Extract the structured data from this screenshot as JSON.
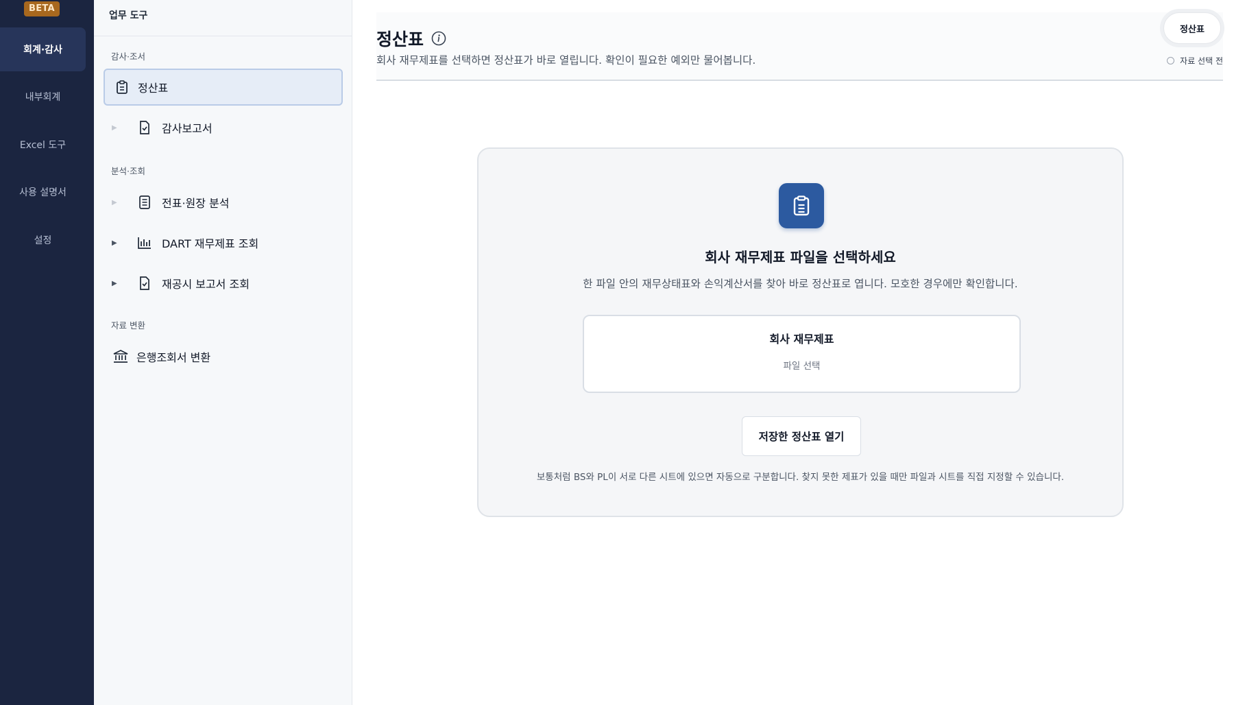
{
  "rail": {
    "badge": "BETA",
    "items": [
      {
        "label": "회계·감사"
      },
      {
        "label": "내부회계"
      },
      {
        "label": "Excel 도구"
      },
      {
        "label": "사용 설명서"
      },
      {
        "label": "설정"
      }
    ]
  },
  "sidebar": {
    "title": "업무 도구",
    "groups": [
      {
        "label": "감사·조서"
      },
      {
        "label": "분석·조회"
      },
      {
        "label": "자료 변환"
      }
    ],
    "items": [
      {
        "label": "정산표",
        "icon": "clipboard-icon"
      },
      {
        "label": "감사보고서",
        "icon": "document-check-icon"
      },
      {
        "label": "전표·원장 분석",
        "icon": "ledger-icon"
      },
      {
        "label": "DART 재무제표 조회",
        "icon": "bar-chart-icon"
      },
      {
        "label": "재공시 보고서 조회",
        "icon": "document-check-icon"
      },
      {
        "label": "은행조회서 변환",
        "icon": "bank-icon"
      }
    ]
  },
  "header": {
    "title": "정산표",
    "description": "회사 재무제표를 선택하면 정산표가 바로 열립니다. 확인이 필요한 예외만 물어봅니다.",
    "pill": "정산표",
    "status": "자료 선택 전"
  },
  "card": {
    "title": "회사 재무제표 파일을 선택하세요",
    "description": "한 파일 안의 재무상태표와 손익계산서를 찾아 바로 정산표로 엽니다. 모호한 경우에만 확인합니다.",
    "file_box_title": "회사 재무제표",
    "file_box_sub": "파일 선택",
    "open_button": "저장한 정산표 열기",
    "note": "보통처럼 BS와 PL이 서로 다른 시트에 있으면 자동으로 구분합니다. 찾지 못한 제표가 있을 때만 파일과 시트를 직접 지정할 수 있습니다."
  },
  "colors": {
    "rail_bg": "#1b2540",
    "accent": "#2c5aa0",
    "badge": "#a8681e"
  }
}
